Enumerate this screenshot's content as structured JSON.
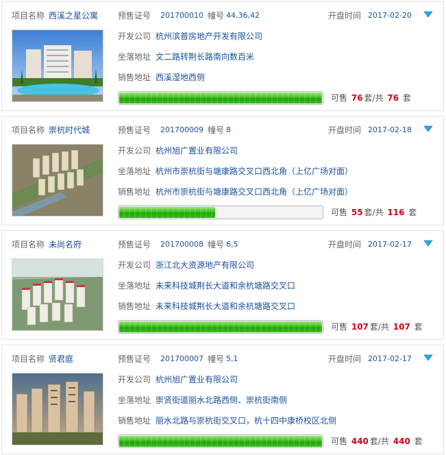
{
  "labels": {
    "project_name": "项目名称",
    "presale_no": "预售证号",
    "building_no": "幢号",
    "open_time": "开盘时间",
    "developer": "开发公司",
    "location": "坐落地址",
    "sales_address": "销售地址",
    "available": "可售",
    "unit": "套",
    "total_sep": "套/共"
  },
  "colors": {
    "link": "#1a4f9c",
    "count": "#d0021b",
    "progress": "#3ec21a",
    "toggle_icon": "#31a7e0"
  },
  "icons": {
    "toggle": "triangle-down-icon"
  },
  "projects": [
    {
      "name": "西溪之星公寓",
      "presale_no": "201700010",
      "building_no": "44,36,42",
      "open_time": "2017-02-20",
      "developer": "杭州滨普房地产开发有限公司",
      "location": "文二路转荆长路南向数百米",
      "sales_address": "西溪湿地西侧",
      "available": "76",
      "total": "76",
      "ratio": 1.0
    },
    {
      "name": "崇杭时代城",
      "presale_no": "201700009",
      "building_no": "8",
      "open_time": "2017-02-18",
      "developer": "杭州旭广置业有限公司",
      "location": "杭州市崇杭街与塘康路交叉口西北角（上亿广场对面）",
      "sales_address": "杭州市崇杭街与塘康路交叉口西北角（上亿广场对面）",
      "available": "55",
      "total": "116",
      "ratio": 0.474
    },
    {
      "name": "未尚名府",
      "presale_no": "201700008",
      "building_no": "6,5",
      "open_time": "2017-02-17",
      "developer": "浙江北大资源地产有限公司",
      "location": "未来科技城荆长大道和余杭塘路交叉口",
      "sales_address": "未来科技城荆长大道和余杭塘路交叉口",
      "available": "107",
      "total": "107",
      "ratio": 1.0
    },
    {
      "name": "贤君庭",
      "presale_no": "201700007",
      "building_no": "5,1",
      "open_time": "2017-02-17",
      "developer": "杭州旭广置业有限公司",
      "location": "崇贤街道丽水北路西侧、崇杭街南侧",
      "sales_address": "丽水北路与崇杭街交叉口，杭十四中康桥校区北侧",
      "available": "440",
      "total": "440",
      "ratio": 1.0
    }
  ]
}
